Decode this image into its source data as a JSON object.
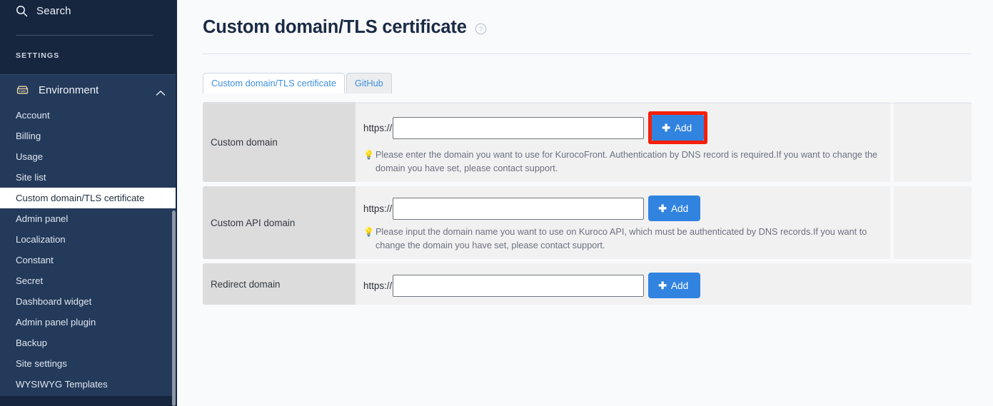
{
  "sidebar": {
    "search": {
      "label": "Search",
      "icon": "search-icon"
    },
    "section_label": "SETTINGS",
    "group": {
      "label": "Environment",
      "icon": "environment-icon",
      "chevron": "chevron-up-icon",
      "expanded": true
    },
    "items": [
      {
        "label": "Account",
        "active": false
      },
      {
        "label": "Billing",
        "active": false
      },
      {
        "label": "Usage",
        "active": false
      },
      {
        "label": "Site list",
        "active": false
      },
      {
        "label": "Custom domain/TLS certificate",
        "active": true
      },
      {
        "label": "Admin panel",
        "active": false
      },
      {
        "label": "Localization",
        "active": false
      },
      {
        "label": "Constant",
        "active": false
      },
      {
        "label": "Secret",
        "active": false
      },
      {
        "label": "Dashboard widget",
        "active": false
      },
      {
        "label": "Admin panel plugin",
        "active": false
      },
      {
        "label": "Backup",
        "active": false
      },
      {
        "label": "Site settings",
        "active": false
      },
      {
        "label": "WYSIWYG Templates",
        "active": false
      }
    ]
  },
  "header": {
    "title": "Custom domain/TLS certificate",
    "help_icon": "help-circle-icon"
  },
  "tabs": [
    {
      "label": "Custom domain/TLS certificate",
      "active": true
    },
    {
      "label": "GitHub",
      "active": false
    }
  ],
  "rows": [
    {
      "label": "Custom domain",
      "protocol": "https://",
      "input_value": "",
      "input_placeholder": "",
      "add_label": "Add",
      "add_icon": "plus-icon",
      "highlighted": true,
      "hint_icon": "lightbulb-icon",
      "hint": "Please enter the domain you want to use for KurocoFront. Authentication by DNS record is required.If you want to change the domain you have set, please contact support.",
      "has_extra_cell": true
    },
    {
      "label": "Custom API domain",
      "protocol": "https://",
      "input_value": "",
      "input_placeholder": "",
      "add_label": "Add",
      "add_icon": "plus-icon",
      "highlighted": false,
      "hint_icon": "lightbulb-icon",
      "hint": "Please input the domain name you want to use on Kuroco API, which must be authenticated by DNS records.If you want to change the domain you have set, please contact support.",
      "has_extra_cell": true
    },
    {
      "label": "Redirect domain",
      "protocol": "https://",
      "input_value": "",
      "input_placeholder": "",
      "add_label": "Add",
      "add_icon": "plus-icon",
      "highlighted": false,
      "hint_icon": "",
      "hint": "",
      "has_extra_cell": false
    }
  ],
  "colors": {
    "sidebar_bg": "#16263f",
    "sidebar_group_bg": "#243a5a",
    "accent_blue": "#3183e0",
    "tab_link": "#3f8fe0",
    "highlight_red": "#f41f0b",
    "label_cell": "#dcdcdc",
    "value_cell": "#f1f1f1",
    "page_bg": "#f8fafc"
  }
}
